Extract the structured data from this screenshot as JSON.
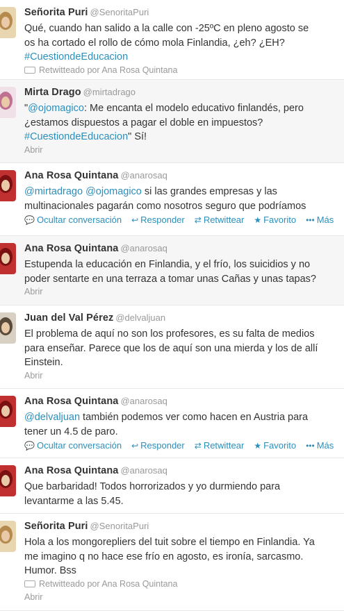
{
  "tweets": [
    {
      "name": "Señorita Puri",
      "handle": "@SenoritaPuri",
      "lines": [
        [
          {
            "t": "Qué, cuando han salido a la calle con -25ºC en pleno agosto se"
          }
        ],
        [
          {
            "t": "os ha cortado el rollo de cómo mola Finlandia, ¿eh? ¿EH?"
          }
        ],
        [
          {
            "t": "#CuestiondeEducacion",
            "link": true
          }
        ]
      ],
      "meta": "Retwitteado por Ana Rosa Quintana",
      "meta_icon": "retweet-icon"
    },
    {
      "name": "Mirta Drago",
      "handle": "@mirtadrago",
      "lines": [
        [
          {
            "t": "\""
          },
          {
            "t": "@ojomagico",
            "link": true
          },
          {
            "t": ": Me encanta el modelo educativo finlandés, pero"
          }
        ],
        [
          {
            "t": "¿estamos dispuestos a pagar el doble en impuestos?"
          }
        ],
        [
          {
            "t": "#CuestiondeEducacion",
            "link": true
          },
          {
            "t": "\" Sí!"
          }
        ]
      ],
      "meta": "Abrir"
    },
    {
      "name": "Ana Rosa Quintana",
      "handle": "@anarosaq",
      "lines": [
        [
          {
            "t": "@mirtadrago",
            "link": true
          },
          {
            "t": " "
          },
          {
            "t": "@ojomagico",
            "link": true
          },
          {
            "t": " si las grandes empresas y las"
          }
        ],
        [
          {
            "t": "multinacionales pagarán como nosotros seguro que podríamos"
          }
        ]
      ],
      "actions": [
        "Ocultar conversación",
        "Responder",
        "Retwittear",
        "Favorito",
        "Más"
      ]
    },
    {
      "name": "Ana Rosa Quintana",
      "handle": "@anarosaq",
      "lines": [
        [
          {
            "t": "Estupenda la educación en Finlandia, y el frío, los suicidios y no"
          }
        ],
        [
          {
            "t": "poder sentarte en una terraza a tomar unas Cañas y unas tapas?"
          }
        ]
      ],
      "meta": "Abrir"
    },
    {
      "name": "Juan del Val Pérez",
      "handle": "@delvaljuan",
      "lines": [
        [
          {
            "t": "El problema de aquí no son los profesores, es su falta de medios"
          }
        ],
        [
          {
            "t": "para enseñar. Parece que los de aquí son una mierda y los de allí"
          }
        ],
        [
          {
            "t": "Einstein."
          }
        ]
      ],
      "meta": "Abrir"
    },
    {
      "name": "Ana Rosa Quintana",
      "handle": "@anarosaq",
      "lines": [
        [
          {
            "t": "@delvaljuan",
            "link": true
          },
          {
            "t": " también podemos ver como hacen en Austria para"
          }
        ],
        [
          {
            "t": "tener un 4.5 de paro."
          }
        ]
      ],
      "actions": [
        "Ocultar conversación",
        "Responder",
        "Retwittear",
        "Favorito",
        "Más"
      ]
    },
    {
      "name": "Ana Rosa Quintana",
      "handle": "@anarosaq",
      "lines": [
        [
          {
            "t": "Que barbaridad! Todos horrorizados y yo durmiendo para"
          }
        ],
        [
          {
            "t": "levantarme a las 5.45."
          }
        ]
      ]
    },
    {
      "name": "Señorita Puri",
      "handle": "@SenoritaPuri",
      "lines": [
        [
          {
            "t": "Hola a los mongorepliers del tuit sobre el tiempo en Finlandia. Ya"
          }
        ],
        [
          {
            "t": "me imagino q no hace ese frío en agosto, es ironía, sarcasmo."
          }
        ],
        [
          {
            "t": "Humor. Bss"
          }
        ]
      ],
      "meta": "Retwitteado por Ana Rosa Quintana",
      "meta_icon": "retweet-icon",
      "meta2": "Abrir"
    }
  ],
  "colors": {
    "link": "#2a8fbd",
    "muted": "#999999",
    "text": "#333333"
  }
}
